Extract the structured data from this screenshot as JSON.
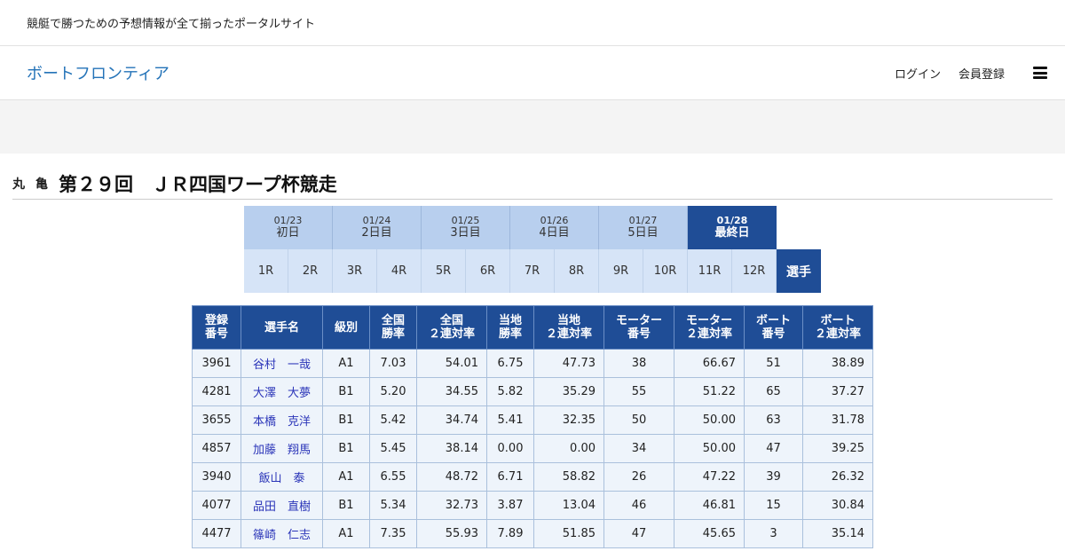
{
  "site": {
    "tagline": "競艇で勝つための予想情報が全て揃ったポータルサイト",
    "logo": "ボートフロンティア",
    "nav": {
      "login": "ログイン",
      "register": "会員登録"
    }
  },
  "race": {
    "venue": "丸亀",
    "title": "第２９回　ＪＲ四国ワープ杯競走"
  },
  "days": [
    {
      "date": "01/23",
      "label": "初日"
    },
    {
      "date": "01/24",
      "label": "2日目"
    },
    {
      "date": "01/25",
      "label": "3日目"
    },
    {
      "date": "01/26",
      "label": "4日目"
    },
    {
      "date": "01/27",
      "label": "5日目"
    },
    {
      "date": "01/28",
      "label": "最終日"
    }
  ],
  "races": [
    "1R",
    "2R",
    "3R",
    "4R",
    "5R",
    "6R",
    "7R",
    "8R",
    "9R",
    "10R",
    "11R",
    "12R"
  ],
  "players_tab": "選手",
  "table": {
    "headers": [
      "登録\n番号",
      "選手名",
      "級別",
      "全国\n勝率",
      "全国\n２連対率",
      "当地\n勝率",
      "当地\n２連対率",
      "モーター\n番号",
      "モーター\n２連対率",
      "ボート\n番号",
      "ボート\n２連対率"
    ],
    "rows": [
      [
        "3961",
        "谷村　一哉",
        "A1",
        "7.03",
        "54.01",
        "6.75",
        "47.73",
        "38",
        "66.67",
        "51",
        "38.89"
      ],
      [
        "4281",
        "大澤　大夢",
        "B1",
        "5.20",
        "34.55",
        "5.82",
        "35.29",
        "55",
        "51.22",
        "65",
        "37.27"
      ],
      [
        "3655",
        "本橋　克洋",
        "B1",
        "5.42",
        "34.74",
        "5.41",
        "32.35",
        "50",
        "50.00",
        "63",
        "31.78"
      ],
      [
        "4857",
        "加藤　翔馬",
        "B1",
        "5.45",
        "38.14",
        "0.00",
        "0.00",
        "34",
        "50.00",
        "47",
        "39.25"
      ],
      [
        "3940",
        "飯山　泰",
        "A1",
        "6.55",
        "48.72",
        "6.71",
        "58.82",
        "26",
        "47.22",
        "39",
        "26.32"
      ],
      [
        "4077",
        "品田　直樹",
        "B1",
        "5.34",
        "32.73",
        "3.87",
        "13.04",
        "46",
        "46.81",
        "15",
        "30.84"
      ],
      [
        "4477",
        "篠崎　仁志",
        "A1",
        "7.35",
        "55.93",
        "7.89",
        "51.85",
        "47",
        "45.65",
        "3",
        "35.14"
      ]
    ]
  },
  "colors": {
    "accent": "#1f4d96",
    "logo": "#2473b8",
    "day_tab": "#b8cfee",
    "race_tab": "#d6e4f7",
    "name_link": "#2a34b8"
  }
}
